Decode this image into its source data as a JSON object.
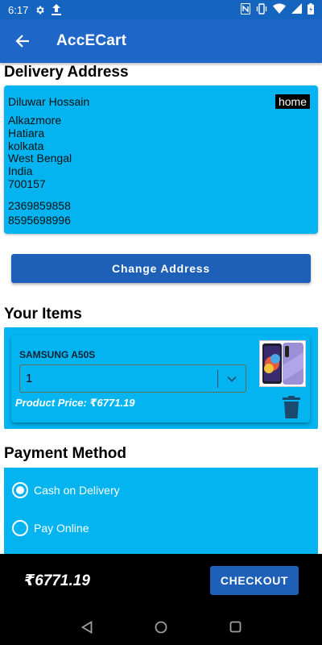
{
  "status_bar": {
    "time": "6:17",
    "left_icons": [
      "settings-icon",
      "upload-icon"
    ],
    "right_icons": [
      "nfc-icon",
      "vibrate-icon",
      "wifi-icon",
      "signal-icon",
      "battery-icon"
    ]
  },
  "app_bar": {
    "title": "AccECart",
    "background": "#1e66c8"
  },
  "delivery": {
    "heading": "Delivery Address",
    "name": "Diluwar Hossain",
    "tag": "home",
    "address_lines": [
      "Alkazmore",
      "Hatiara",
      "kolkata",
      "West Bengal",
      "India",
      "700157"
    ],
    "phones": [
      "2369859858",
      "8595698996"
    ],
    "change_button_label": "Change Address"
  },
  "items": {
    "heading": "Your Items",
    "list": [
      {
        "name": "SAMSUNG A50S",
        "quantity": "1",
        "price_label": "Product Price: ₹6771.19"
      }
    ]
  },
  "payment": {
    "heading": "Payment Method",
    "options": [
      {
        "label": "Cash on Delivery",
        "selected": true
      },
      {
        "label": "Pay Online",
        "selected": false
      }
    ]
  },
  "footer": {
    "total": "₹6771.19",
    "checkout_label": "CHECKOUT"
  },
  "colors": {
    "primary": "#1e66c8",
    "card": "#03b4f1",
    "button": "#1e5fb8"
  }
}
